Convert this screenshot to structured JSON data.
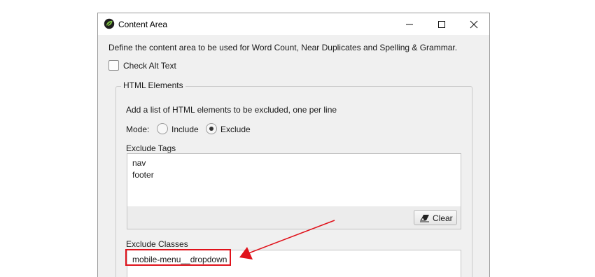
{
  "window": {
    "title": "Content Area",
    "icons": [
      "app-leaf-icon",
      "minimize-icon",
      "maximize-icon",
      "close-icon"
    ]
  },
  "description": "Define the content area to be used for Word Count, Near Duplicates and Spelling & Grammar.",
  "alt_text": {
    "label": "Check Alt Text",
    "checked": false
  },
  "html_elements": {
    "legend": "HTML Elements",
    "hint": "Add a list of HTML elements to be excluded, one per line",
    "mode": {
      "label": "Mode:",
      "options": [
        "Include",
        "Exclude"
      ],
      "selected": "Exclude"
    },
    "exclude_tags": {
      "label": "Exclude Tags",
      "lines": [
        "nav",
        "footer"
      ],
      "clear_label": "Clear"
    },
    "exclude_classes": {
      "label": "Exclude Classes",
      "lines": [
        "mobile-menu__dropdown"
      ]
    }
  },
  "annotation": {
    "color": "#e0121b"
  }
}
